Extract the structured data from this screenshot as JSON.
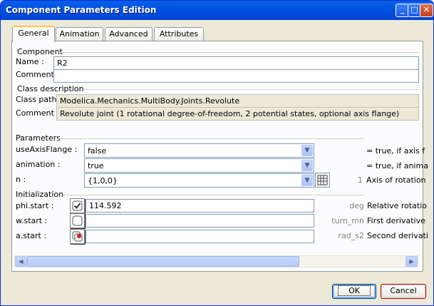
{
  "window": {
    "title": "Component Parameters Edition"
  },
  "titlebar_buttons": {
    "minimize": "_",
    "maximize": "□",
    "close": "✕"
  },
  "tabs": [
    {
      "label": "General",
      "active": true
    },
    {
      "label": "Animation",
      "active": false
    },
    {
      "label": "Advanced",
      "active": false
    },
    {
      "label": "Attributes",
      "active": false
    }
  ],
  "component": {
    "header": "Component",
    "name_label": "Name :",
    "name_value": "R2",
    "comment_label": "Comment :",
    "comment_value": ""
  },
  "class_description": {
    "header": "Class description",
    "path_label": "Class path :",
    "path_value": "Modelica.Mechanics.MultiBody.Joints.Revolute",
    "comment_label": "Comment :",
    "comment_value": "Revolute joint (1 rotational degree-of-freedom, 2 potential states, optional axis flange)"
  },
  "parameters": {
    "header": "Parameters",
    "rows": [
      {
        "label": "useAxisFlange :",
        "value": "false",
        "unit": "",
        "description": "= true, if axis f"
      },
      {
        "label": "animation :",
        "value": "true",
        "unit": "",
        "description": "= true, if anima"
      },
      {
        "label": "n :",
        "value": "{1,0,0}",
        "unit": "1",
        "description": "Axis of rotation"
      }
    ]
  },
  "initialization": {
    "header": "Initialization",
    "rows": [
      {
        "label": "phi.start :",
        "value": "114.592",
        "unit": "deg",
        "description": "Relative rotatio",
        "icon": "checked-icon"
      },
      {
        "label": "w.start :",
        "value": "",
        "unit": "turn_mn",
        "description": "First derivative",
        "icon": "unchecked-icon"
      },
      {
        "label": "a.start :",
        "value": "",
        "unit": "rad_s2",
        "description": "Second derivati",
        "icon": "fixed-state-icon"
      }
    ]
  },
  "icons": {
    "dropdown": "dropdown-arrow-icon",
    "matrix_editor": "matrix-editor-icon"
  },
  "buttons": {
    "ok": "OK",
    "cancel": "Cancel"
  },
  "colors": {
    "titlebar": "#0054e3",
    "dialog_bg": "#ece9d8",
    "active_tab_accent": "#ffc83c",
    "cancel_border": "#9d0e0e"
  }
}
